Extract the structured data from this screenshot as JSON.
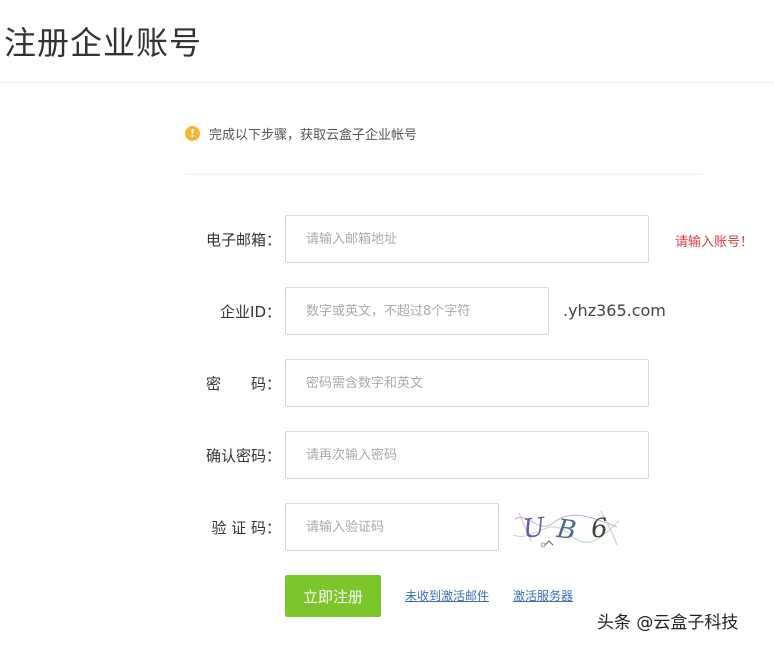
{
  "page": {
    "title": "注册企业账号"
  },
  "notice": {
    "icon": "warning-icon",
    "icon_glyph": "!",
    "icon_color": "#f5b52e",
    "text": "完成以下步骤，获取云盒子企业帐号"
  },
  "form": {
    "email": {
      "label": "电子邮箱：",
      "placeholder": "请输入邮箱地址",
      "value": "",
      "error": "请输入账号！"
    },
    "company_id": {
      "label": "企业ID：",
      "placeholder": "数字或英文，不超过8个字符",
      "value": "",
      "suffix": ".yhz365.com"
    },
    "password": {
      "label": "密　　码：",
      "placeholder": "密码需含数字和英文",
      "value": ""
    },
    "confirm_password": {
      "label": "确认密码：",
      "placeholder": "请再次输入密码",
      "value": ""
    },
    "captcha": {
      "label": "验 证 码：",
      "placeholder": "请输入验证码",
      "value": "",
      "image_text": "UB6"
    }
  },
  "actions": {
    "submit_label": "立即注册",
    "resend_link": "未收到激活邮件",
    "activate_link": "激活服务器"
  },
  "watermark": {
    "text": "头条 @云盒子科技"
  },
  "colors": {
    "accent_green": "#7cc52a",
    "error_red": "#e4393c",
    "link_blue": "#3a6fb6",
    "notice_yellow": "#f5b52e"
  }
}
